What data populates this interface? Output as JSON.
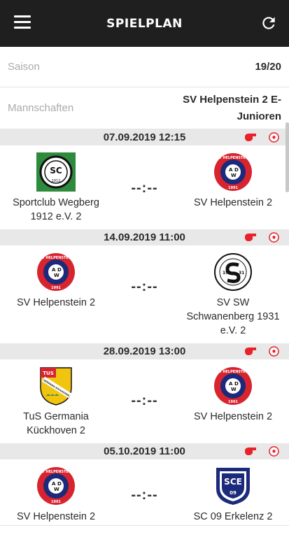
{
  "header": {
    "title": "SPIELPLAN",
    "menu_icon": "hamburger-menu-icon",
    "refresh_icon": "refresh-icon",
    "background": "#1f1f1f"
  },
  "filters": {
    "season": {
      "label": "Saison",
      "value": "19/20"
    },
    "team": {
      "label": "Mannschaften",
      "value_line1": "SV Helpenstein 2 E-",
      "value_line2": "Junioren"
    }
  },
  "colors": {
    "accent": "#e8212a",
    "date_bar": "#e8e8e8"
  },
  "matches": [
    {
      "date": "07.09.2019 12:15",
      "home": {
        "name": "Sportclub Wegberg 1912 e.V. 2",
        "logo": "sc-wegberg-logo"
      },
      "away": {
        "name": "SV Helpenstein 2",
        "logo": "sv-helpenstein-logo"
      },
      "score": "--:--"
    },
    {
      "date": "14.09.2019 11:00",
      "home": {
        "name": "SV Helpenstein 2",
        "logo": "sv-helpenstein-logo"
      },
      "away": {
        "name": "SV SW Schwanenberg 1931 e.V. 2",
        "logo": "sv-sw-schwanenberg-logo"
      },
      "score": "--:--"
    },
    {
      "date": "28.09.2019 13:00",
      "home": {
        "name": "TuS Germania Kückhoven 2",
        "logo": "tus-germania-logo"
      },
      "away": {
        "name": "SV Helpenstein 2",
        "logo": "sv-helpenstein-logo"
      },
      "score": "--:--"
    },
    {
      "date": "05.10.2019 11:00",
      "home": {
        "name": "SV Helpenstein 2",
        "logo": "sv-helpenstein-logo"
      },
      "away": {
        "name": "SC 09 Erkelenz 2",
        "logo": "sc-09-erkelenz-logo"
      },
      "score": "--:--"
    }
  ],
  "logo_text": {
    "helpenstein_ring": "SV HELPENSTEIN",
    "helpenstein_letters": [
      "A",
      "D",
      "W"
    ],
    "helpenstein_year": "1991",
    "wegberg": "SC",
    "wegberg_year": "1912",
    "schwanenberg_left": "19",
    "schwanenberg_right": "31",
    "germania_tus": "TUS",
    "germania_band": "GERMANIA KÜCKHOVEN",
    "erkelenz": "SCE",
    "erkelenz_year": "09"
  }
}
